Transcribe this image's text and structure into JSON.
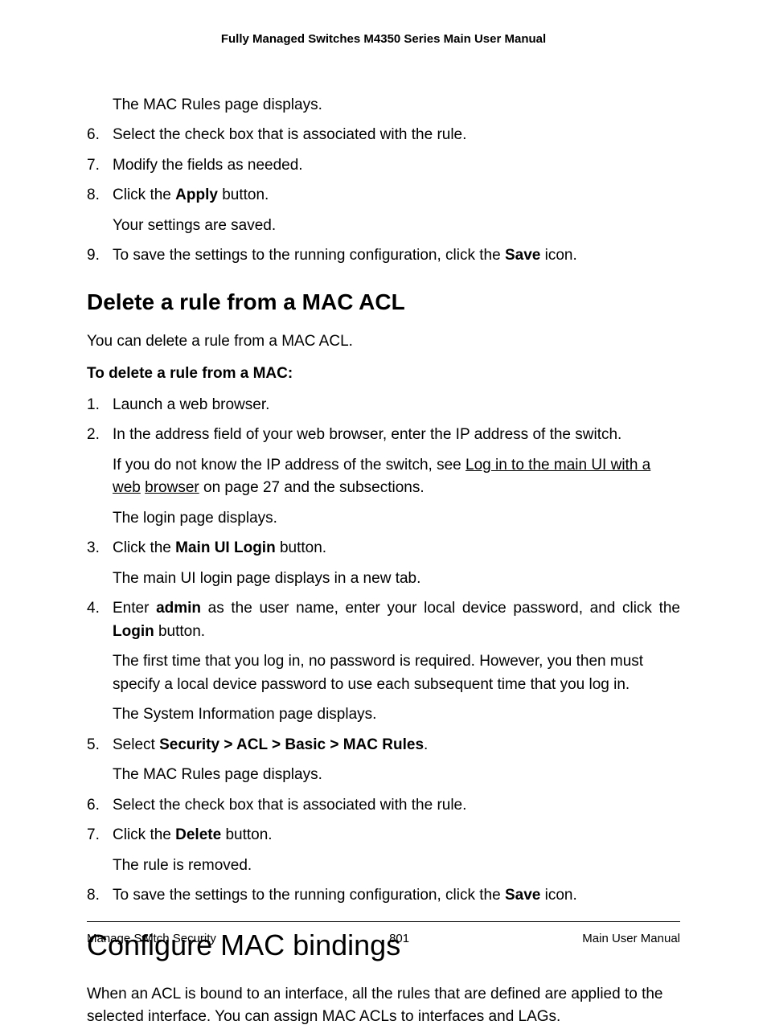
{
  "header": {
    "running_title": "Fully Managed Switches M4350 Series Main User Manual"
  },
  "top_steps": {
    "s5_follow": "The MAC Rules page displays.",
    "s6_num": "6.",
    "s6": "Select the check box that is associated with the rule.",
    "s7_num": "7.",
    "s7": "Modify the fields as needed.",
    "s8_num": "8.",
    "s8_a": "Click the ",
    "s8_b": "Apply",
    "s8_c": " button.",
    "s8_follow": "Your settings are saved.",
    "s9_num": "9.",
    "s9_a": "To save the settings to the running configuration, click the ",
    "s9_b": "Save",
    "s9_c": " icon."
  },
  "section2": {
    "title": "Delete a rule from a MAC ACL",
    "intro": "You can delete a rule from a MAC ACL.",
    "subhead": "To delete a rule from a MAC:",
    "s1_num": "1.",
    "s1": "Launch a web browser.",
    "s2_num": "2.",
    "s2": "In the address field of your web browser, enter the IP address of the switch.",
    "s2_f1_a": "If you do not know the IP address of the switch, see ",
    "s2_f1_link1": "Log in to the main UI with a web",
    "s2_f1_link2": "browser",
    "s2_f1_b": " on page 27 and the subsections.",
    "s2_f2": "The login page displays.",
    "s3_num": "3.",
    "s3_a": "Click the ",
    "s3_b": "Main UI Login",
    "s3_c": " button.",
    "s3_f": "The main UI login page displays in a new tab.",
    "s4_num": "4.",
    "s4_a": "Enter ",
    "s4_b": "admin",
    "s4_c": " as the user name, enter your local device password, and click the ",
    "s4_d": "Login",
    "s4_e": " button.",
    "s4_f1": "The first time that you log in, no password is required. However, you then must specify a local device password to use each subsequent time that you log in.",
    "s4_f2": "The System Information page displays.",
    "s5_num": "5.",
    "s5_a": "Select ",
    "s5_b": "Security > ACL > Basic > MAC Rules",
    "s5_c": ".",
    "s5_f": "The MAC Rules page displays.",
    "s6_num": "6.",
    "s6": "Select the check box that is associated with the rule.",
    "s7_num": "7.",
    "s7_a": "Click the ",
    "s7_b": "Delete",
    "s7_c": " button.",
    "s7_f": "The rule is removed.",
    "s8_num": "8.",
    "s8_a": "To save the settings to the running configuration, click the ",
    "s8_b": "Save",
    "s8_c": " icon."
  },
  "section3": {
    "title": "Configure MAC bindings",
    "para": "When an ACL is bound to an interface, all the rules that are defined are applied to the selected interface. You can assign MAC ACLs to interfaces and LAGs."
  },
  "footer": {
    "left": "Manage Switch Security",
    "center": "801",
    "right": "Main User Manual"
  }
}
